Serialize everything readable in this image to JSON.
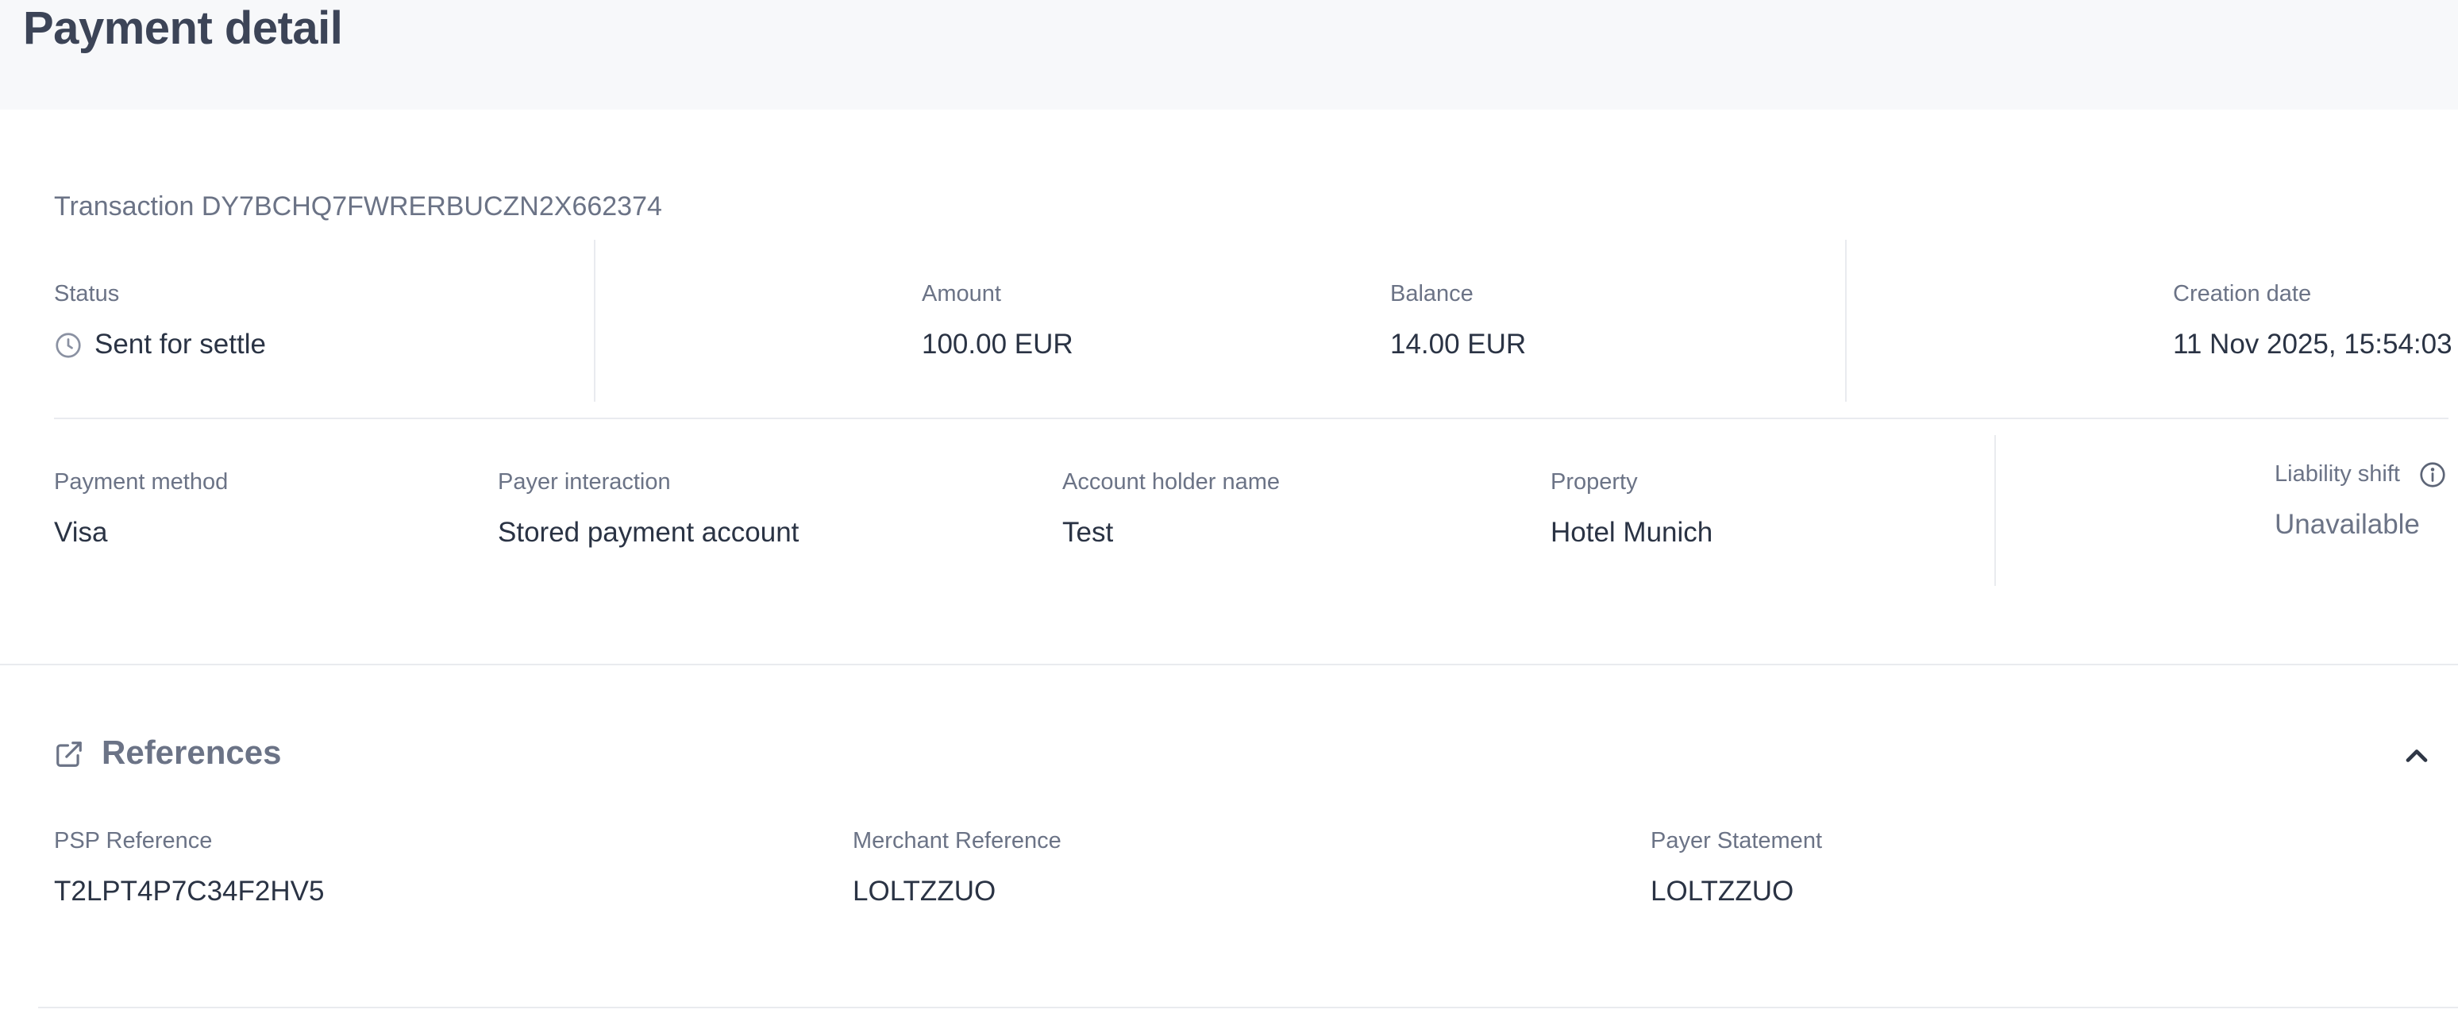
{
  "header": {
    "title": "Payment detail"
  },
  "transaction": {
    "label": "Transaction DY7BCHQ7FWRERBUCZN2X662374",
    "status_label": "Status",
    "status_value": "Sent for settle",
    "amount_label": "Amount",
    "amount_value": "100.00 EUR",
    "balance_label": "Balance",
    "balance_value": "14.00 EUR",
    "creation_date_label": "Creation date",
    "creation_date_value": "11 Nov 2025, 15:54:03",
    "payment_method_label": "Payment method",
    "payment_method_value": "Visa",
    "payer_interaction_label": "Payer interaction",
    "payer_interaction_value": "Stored payment account",
    "account_holder_label": "Account holder name",
    "account_holder_value": "Test",
    "property_label": "Property",
    "property_value": "Hotel Munich",
    "liability_shift_label": "Liability shift",
    "liability_shift_value": "Unavailable"
  },
  "references": {
    "title": "References",
    "psp_label": "PSP Reference",
    "psp_value": "T2LPT4P7C34F2HV5",
    "merchant_label": "Merchant Reference",
    "merchant_value": "LOLTZZUO",
    "payer_statement_label": "Payer Statement",
    "payer_statement_value": "LOLTZZUO"
  },
  "icons": {
    "status": "clock-icon",
    "liability_info": "info-icon",
    "references": "external-link-icon",
    "collapse": "chevron-up-icon"
  },
  "colors": {
    "text_primary": "#2a3344",
    "text_secondary": "#6b7386",
    "divider": "#e9ebef",
    "header_bg": "#f7f8fa"
  }
}
